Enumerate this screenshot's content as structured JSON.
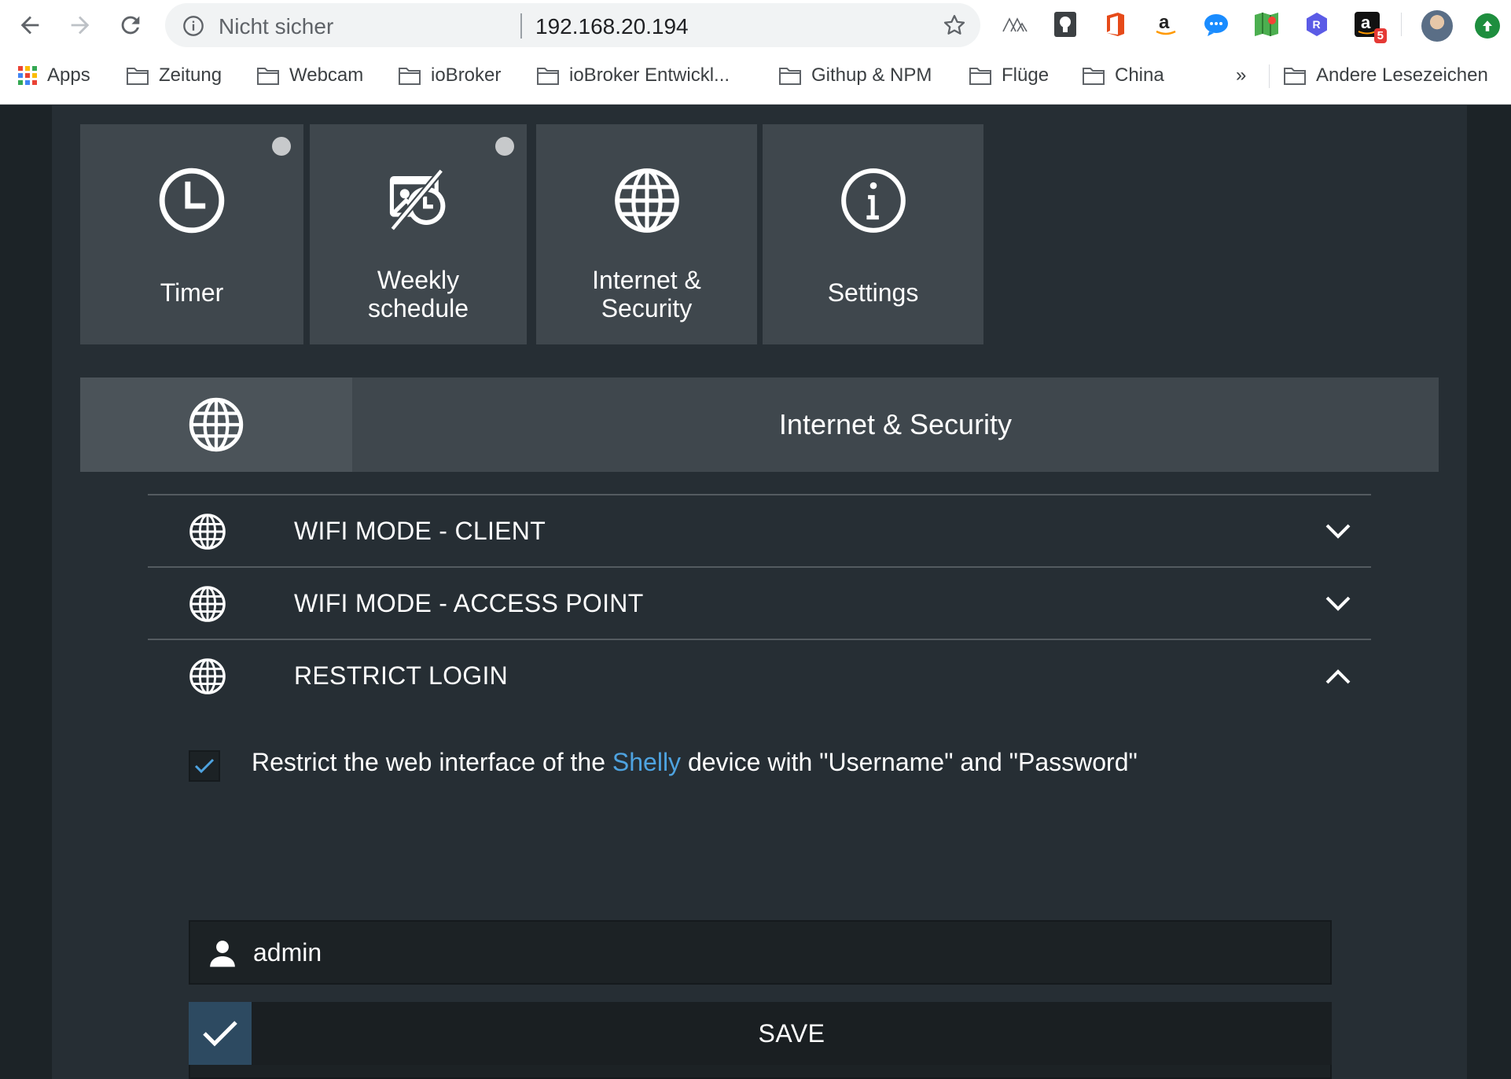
{
  "browser": {
    "security_label": "Nicht sicher",
    "url": "192.168.20.194",
    "extensions": [
      "triangles-extension-icon",
      "keeper-extension-icon",
      "office-extension-icon",
      "amazon-assistant-icon",
      "messenger-extension-icon",
      "maps-extension-icon",
      "rakuten-extension-icon",
      "amazon-extension-icon"
    ],
    "amazon_badge": "5",
    "bookmarks": [
      {
        "label": "Apps",
        "icon": "apps-grid-icon"
      },
      {
        "label": "Zeitung",
        "icon": "folder-icon"
      },
      {
        "label": "Webcam",
        "icon": "folder-icon"
      },
      {
        "label": "ioBroker",
        "icon": "folder-icon"
      },
      {
        "label": "ioBroker Entwickl...",
        "icon": "folder-icon"
      },
      {
        "label": "Githup & NPM",
        "icon": "folder-icon"
      },
      {
        "label": "Flüge",
        "icon": "folder-icon"
      },
      {
        "label": "China",
        "icon": "folder-icon"
      }
    ],
    "bookmarks_overflow": "»",
    "other_bookmarks": "Andere Lesezeichen"
  },
  "tiles": [
    {
      "label_lines": [
        "Timer"
      ],
      "icon": "clock-icon",
      "indicator": true
    },
    {
      "label_lines": [
        "Weekly",
        "schedule"
      ],
      "icon": "schedule-icon",
      "indicator": true
    },
    {
      "label_lines": [
        "Internet &",
        "Security"
      ],
      "icon": "globe-icon",
      "indicator": false
    },
    {
      "label_lines": [
        "Settings"
      ],
      "icon": "info-icon",
      "indicator": false
    }
  ],
  "section": {
    "title": "Internet & Security",
    "icon": "globe-icon"
  },
  "accordion": [
    {
      "title": "WIFI MODE - CLIENT",
      "expanded": false
    },
    {
      "title": "WIFI MODE - ACCESS POINT",
      "expanded": false
    },
    {
      "title": "RESTRICT LOGIN",
      "expanded": true
    }
  ],
  "restrict_login": {
    "checked": true,
    "text_before": "Restrict the web interface of the ",
    "brand": "Shelly",
    "text_after": " device with \"Username\" and \"Password\"",
    "username": "admin",
    "password_masked": "••••••••",
    "save_label": "SAVE"
  },
  "colors": {
    "page_bg": "#262e34",
    "tile_bg": "#3f474d",
    "accent_blue": "#4ea3e0",
    "save_check_bg": "#2d4a61"
  }
}
